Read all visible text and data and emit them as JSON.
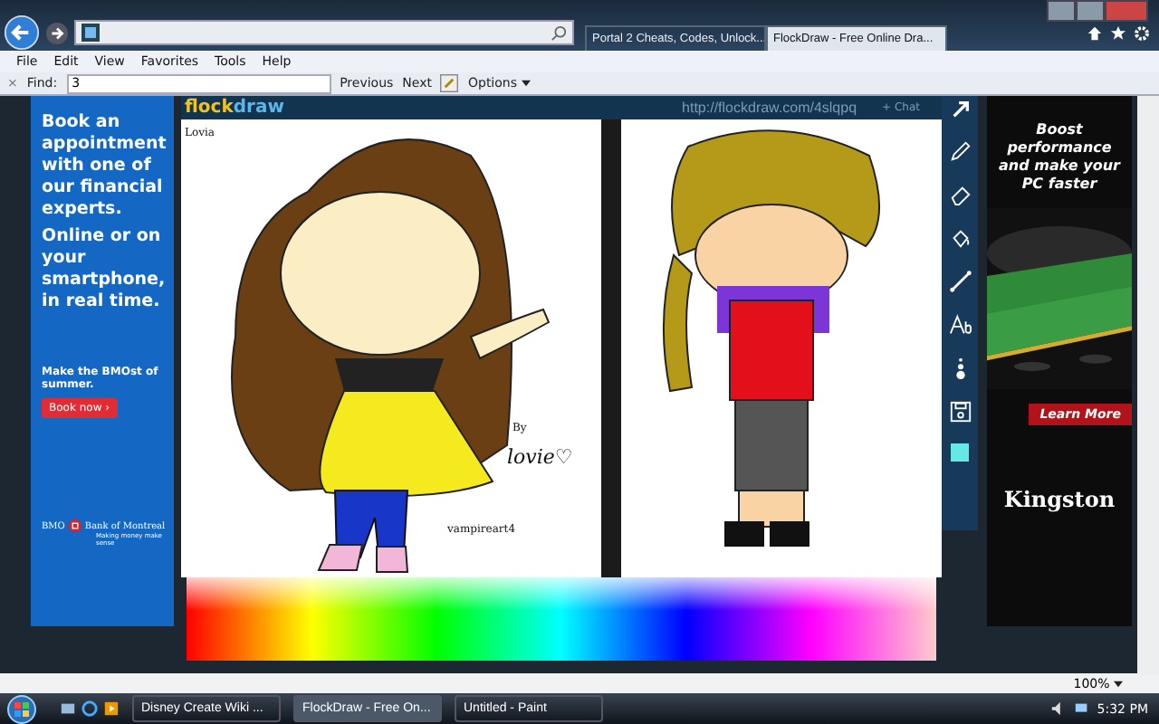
{
  "browser": {
    "tabs": [
      {
        "label": "Portal 2 Cheats, Codes, Unlock...",
        "selected": false
      },
      {
        "label": "FlockDraw - Free Online Dra...",
        "selected": true
      }
    ],
    "menu": [
      "File",
      "Edit",
      "View",
      "Favorites",
      "Tools",
      "Help"
    ],
    "find_bar": {
      "close": "×",
      "label": "Find:",
      "value": "3",
      "buttons": [
        "Previous",
        "Next"
      ],
      "options": "Options"
    }
  },
  "left_ad": {
    "headline": "Book an appointment with one of our financial experts.",
    "subline": "Online or on your smartphone, in real time.",
    "tagline": "Make the BMOst of summer.",
    "button": "Book now ›",
    "logo": "BMO",
    "brand": "Bank of Montreal",
    "slogan": "Making money make sense"
  },
  "flockdraw": {
    "logo": [
      "flock",
      "draw"
    ],
    "url": "http://flockdraw.com/4slqpq",
    "chat": "+ Chat",
    "canvas_texts": {
      "title": "Lovia",
      "by": "By",
      "signature": "lovie♡",
      "credit": "vampireart4"
    },
    "tools": [
      {
        "kind": "pencil"
      },
      {
        "kind": "eraser"
      },
      {
        "kind": "fill"
      },
      {
        "kind": "line"
      },
      {
        "kind": "text"
      },
      {
        "kind": "size"
      },
      {
        "kind": "save"
      },
      {
        "kind": "swatch"
      }
    ]
  },
  "right_ad": {
    "headline": "Boost performance and make your PC faster",
    "button": "Learn More",
    "brand": "Kingston"
  },
  "status_bar": {
    "zoom": "100%"
  },
  "taskbar": {
    "tasks": [
      {
        "label": "Disney Create Wiki ...",
        "selected": false
      },
      {
        "label": "FlockDraw - Free On...",
        "selected": true
      },
      {
        "label": "Untitled - Paint",
        "selected": false
      }
    ],
    "clock": "5:32 PM"
  }
}
